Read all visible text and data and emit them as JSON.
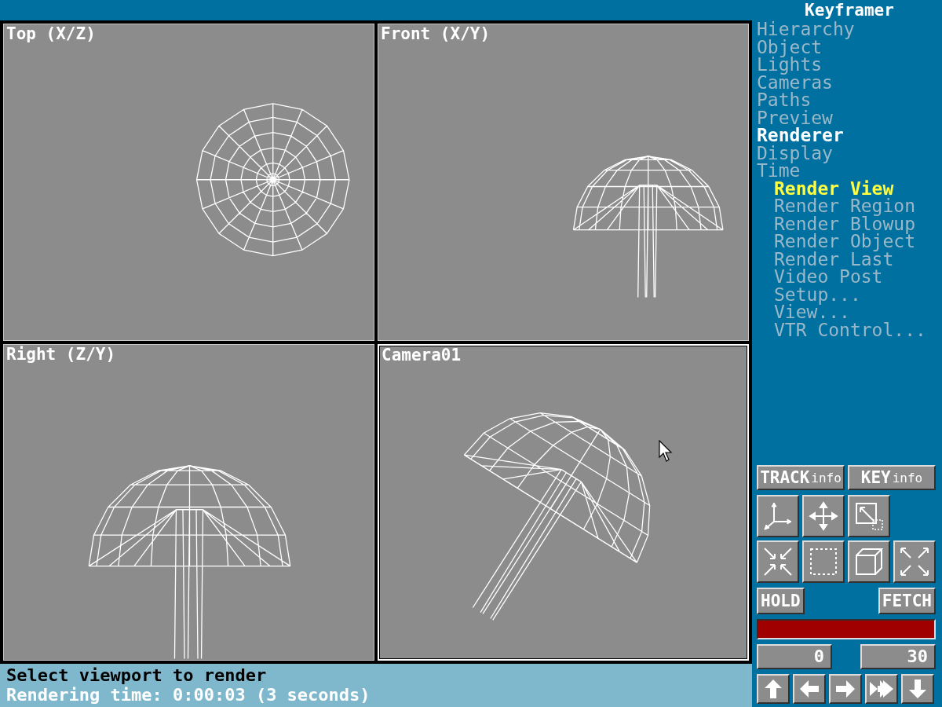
{
  "viewports": [
    {
      "label": "Top (X/Z)",
      "kind": "top",
      "active": false
    },
    {
      "label": "Front (X/Y)",
      "kind": "front",
      "active": false
    },
    {
      "label": "Right (Z/Y)",
      "kind": "right",
      "active": false
    },
    {
      "label": "Camera01",
      "kind": "camera",
      "active": true
    }
  ],
  "menu": {
    "title": "Keyframer",
    "items": [
      {
        "label": "Hierarchy",
        "selected": false
      },
      {
        "label": "Object",
        "selected": false
      },
      {
        "label": "Lights",
        "selected": false
      },
      {
        "label": "Cameras",
        "selected": false
      },
      {
        "label": "Paths",
        "selected": false
      },
      {
        "label": "Preview",
        "selected": false
      },
      {
        "label": "Renderer",
        "selected": true
      },
      {
        "label": "Display",
        "selected": false
      },
      {
        "label": "Time",
        "selected": false
      }
    ],
    "subitems": [
      {
        "label": "Render View",
        "selected": true
      },
      {
        "label": "Render Region",
        "selected": false
      },
      {
        "label": "Render Blowup",
        "selected": false
      },
      {
        "label": "Render Object",
        "selected": false
      },
      {
        "label": "Render Last",
        "selected": false
      },
      {
        "label": "Video Post",
        "selected": false
      },
      {
        "label": "Setup...",
        "selected": false
      },
      {
        "label": "View...",
        "selected": false
      },
      {
        "label": "VTR Control...",
        "selected": false
      }
    ]
  },
  "info_buttons": [
    {
      "main": "TRACK",
      "sub": "info"
    },
    {
      "main": "KEY",
      "sub": "info"
    }
  ],
  "hold_button": "HOLD",
  "fetch_button": "FETCH",
  "frame_slider": {
    "level": 1
  },
  "frame_fields": [
    "0",
    "30"
  ],
  "status": {
    "prompt": "Select viewport to render",
    "info": "Rendering time: 0:00:03 (3 seconds)"
  }
}
